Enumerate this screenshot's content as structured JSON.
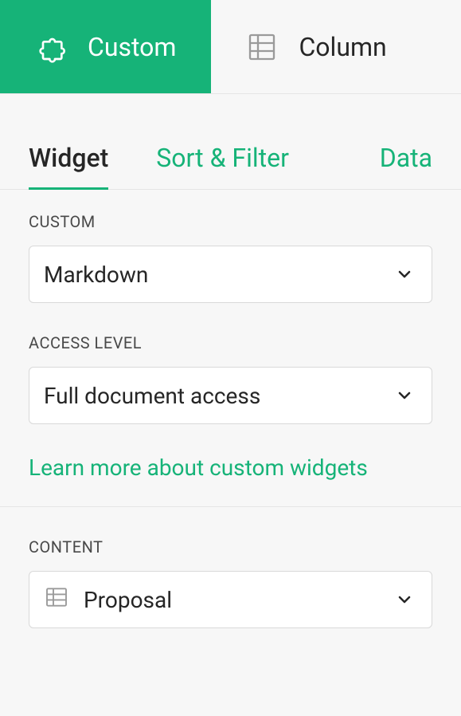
{
  "topTabs": {
    "custom": "Custom",
    "column": "Column"
  },
  "subTabs": {
    "widget": "Widget",
    "sortFilter": "Sort & Filter",
    "data": "Data"
  },
  "sections": {
    "customLabel": "CUSTOM",
    "customValue": "Markdown",
    "accessLabel": "ACCESS LEVEL",
    "accessValue": "Full document access",
    "learnMore": "Learn more about custom widgets",
    "contentLabel": "CONTENT",
    "contentValue": "Proposal"
  }
}
